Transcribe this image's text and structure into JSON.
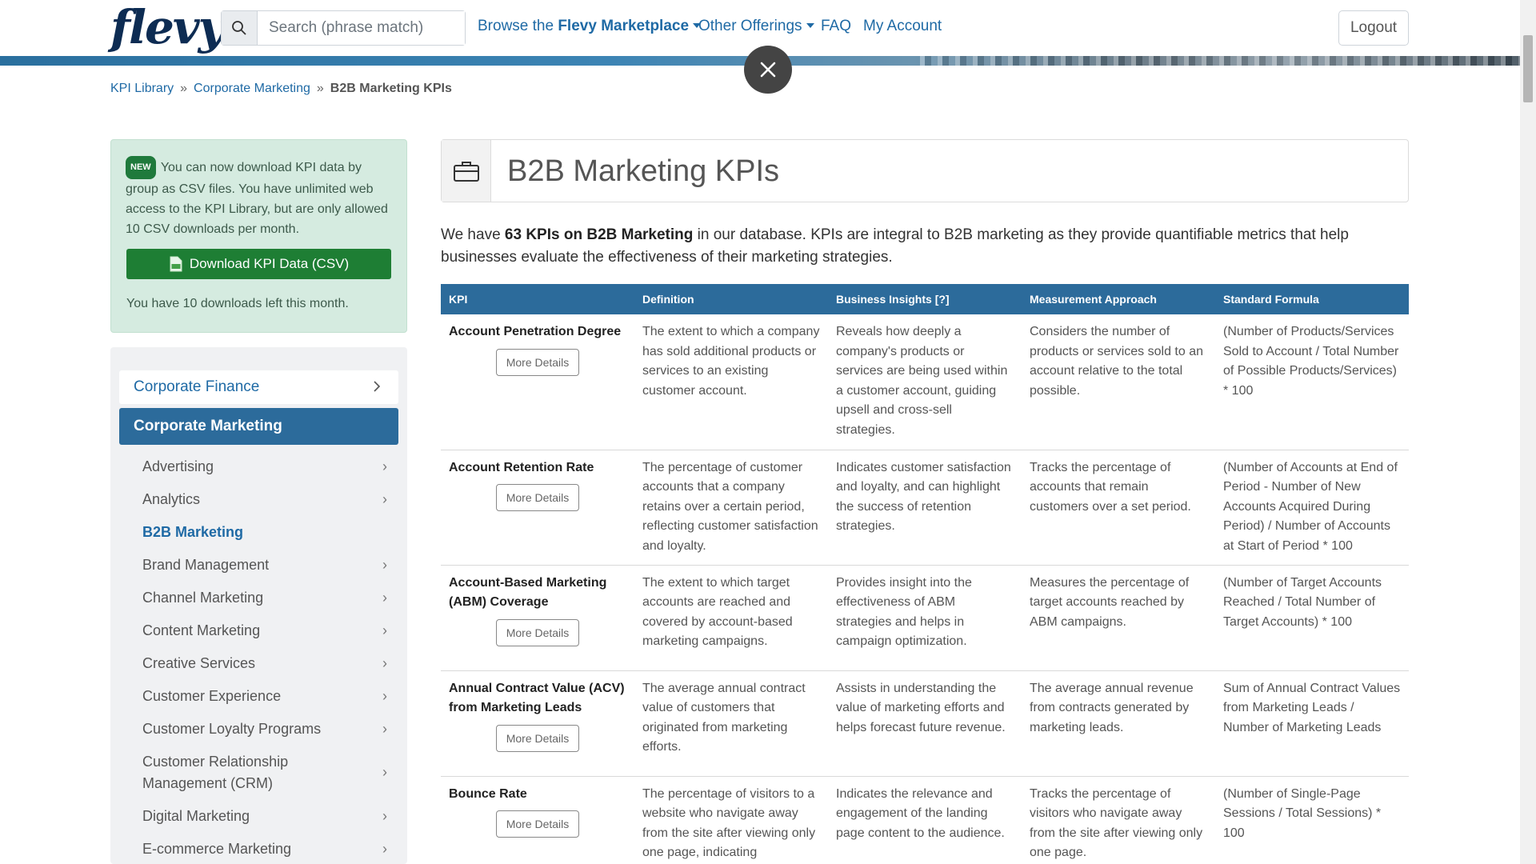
{
  "header": {
    "logo_text": "flevy",
    "search_placeholder": "Search (phrase match)",
    "nav_browse_prefix": "Browse the ",
    "nav_browse_bold": "Flevy Marketplace",
    "nav_other": "Other Offerings",
    "nav_faq": "FAQ",
    "nav_account": "My Account",
    "logout_label": "Logout"
  },
  "breadcrumb": {
    "items": [
      "KPI Library",
      "Corporate Marketing"
    ],
    "separator": "»",
    "current": "B2B Marketing KPIs"
  },
  "notice": {
    "badge": "NEW",
    "text": "You can now download KPI data by group as CSV files. You have unlimited web access to the KPI Library, but are only allowed 10 CSV downloads per month.",
    "download_label": "Download KPI Data (CSV)",
    "downloads_left": "You have 10 downloads left this month."
  },
  "sidebar": {
    "top_item": "Corporate Finance",
    "active_item": "Corporate Marketing",
    "subitems": [
      {
        "label": "Advertising",
        "arrow": "›"
      },
      {
        "label": "Analytics",
        "arrow": "›"
      },
      {
        "label": "B2B Marketing",
        "arrow": ""
      },
      {
        "label": "Brand Management",
        "arrow": "›"
      },
      {
        "label": "Channel Marketing",
        "arrow": "›"
      },
      {
        "label": "Content Marketing",
        "arrow": "›"
      },
      {
        "label": "Creative Services",
        "arrow": "›"
      },
      {
        "label": "Customer Experience",
        "arrow": "›"
      },
      {
        "label": "Customer Loyalty Programs",
        "arrow": "›"
      },
      {
        "label": "Customer Relationship Management (CRM)",
        "arrow": "›"
      },
      {
        "label": "Digital Marketing",
        "arrow": "›"
      },
      {
        "label": "E-commerce Marketing",
        "arrow": "›"
      }
    ]
  },
  "main": {
    "title": "B2B Marketing KPIs",
    "intro_prefix": "We have ",
    "intro_bold": "63 KPIs on B2B Marketing",
    "intro_suffix": " in our database. KPIs are integral to B2B marketing as they provide quantifiable metrics that help businesses evaluate the effectiveness of their marketing strategies.",
    "table": {
      "headers": [
        "KPI",
        "Definition",
        "Business Insights [?]",
        "Measurement Approach",
        "Standard Formula"
      ],
      "more_label": "More Details",
      "rows": [
        {
          "kpi": "Account Penetration Degree",
          "definition": "The extent to which a company has sold additional products or services to an existing customer account.",
          "insights": "Reveals how deeply a company's products or services are being used within a customer account, guiding upsell and cross-sell strategies.",
          "approach": "Considers the number of products or services sold to an account relative to the total possible.",
          "formula": "(Number of Products/Services Sold to Account / Total Number of Possible Products/Services) * 100"
        },
        {
          "kpi": "Account Retention Rate",
          "definition": "The percentage of customer accounts that a company retains over a certain period, reflecting customer satisfaction and loyalty.",
          "insights": "Indicates customer satisfaction and loyalty, and can highlight the success of retention strategies.",
          "approach": "Tracks the percentage of accounts that remain customers over a set period.",
          "formula": "(Number of Accounts at End of Period - Number of New Accounts Acquired During Period) / Number of Accounts at Start of Period * 100"
        },
        {
          "kpi": "Account-Based Marketing (ABM) Coverage",
          "definition": "The extent to which target accounts are reached and covered by account-based marketing campaigns.",
          "insights": "Provides insight into the effectiveness of ABM strategies and helps in campaign optimization.",
          "approach": "Measures the percentage of target accounts reached by ABM campaigns.",
          "formula": "(Number of Target Accounts Reached / Total Number of Target Accounts) * 100"
        },
        {
          "kpi": "Annual Contract Value (ACV) from Marketing Leads",
          "definition": "The average annual contract value of customers that originated from marketing efforts.",
          "insights": "Assists in understanding the value of marketing efforts and helps forecast future revenue.",
          "approach": "The average annual revenue from contracts generated by marketing leads.",
          "formula": "Sum of Annual Contract Values from Marketing Leads / Number of Marketing Leads"
        },
        {
          "kpi": "Bounce Rate",
          "definition": "The percentage of visitors to a website who navigate away from the site after viewing only one page, indicating",
          "insights": "Indicates the relevance and engagement of the landing page content to the audience.",
          "approach": "Tracks the percentage of visitors who navigate away from the site after viewing only one page.",
          "formula": "(Number of Single-Page Sessions / Total Sessions) * 100"
        }
      ]
    }
  }
}
